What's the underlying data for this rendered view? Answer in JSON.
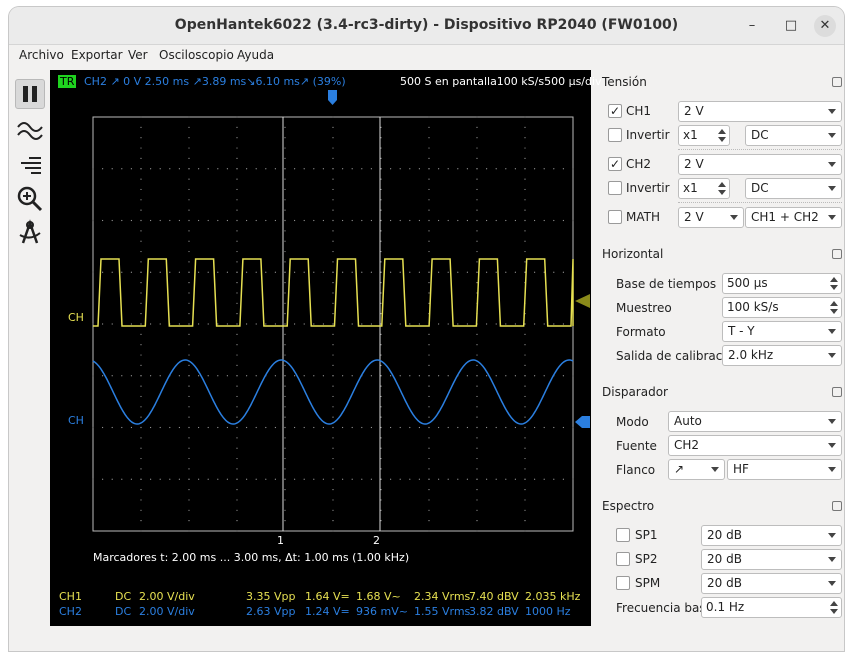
{
  "window": {
    "title": "OpenHantek6022 (3.4-rc3-dirty) - Dispositivo RP2040 (FW0100)",
    "minimize_glyph": "–",
    "maximize_glyph": "□",
    "close_glyph": "✕"
  },
  "menu": [
    "Archivo",
    "Exportar",
    "Ver",
    "Osciloscopio",
    "Ayuda"
  ],
  "toolbar": [
    "pause-icon",
    "wave-icon",
    "levels-icon",
    "zoom-icon",
    "measure-icon"
  ],
  "scope": {
    "trigger_badge": "TR",
    "header_left": "CH2  ↗  0 V  2.50 ms  ↗3.89 ms↘6.10 ms↗ (39%)",
    "header_right": "500 S en pantalla100 kS/s500 µs/div",
    "ch1_label": "CH",
    "ch2_label": "CH",
    "marker1": "1",
    "marker2": "2",
    "markers_text": "Marcadores   t: 2.00 ms ... 3.00 ms,  Δt: 1.00 ms (1.00 kHz)",
    "colors": {
      "ch1": "#e6e052",
      "ch2": "#2b7fe0",
      "grid": "#9a9a9a"
    },
    "measurements": [
      {
        "ch": "CH1",
        "coupling": "DC",
        "scale": "2.00 V/div",
        "vpp": "3.35 Vpp",
        "vdc": "1.64 V=",
        "vac": "1.68 V~",
        "vrms": "2.34 Vrms",
        "dbv": "7.40 dBV",
        "freq": "2.035 kHz"
      },
      {
        "ch": "CH2",
        "coupling": "DC",
        "scale": "2.00 V/div",
        "vpp": "2.63 Vpp",
        "vdc": "1.24 V=",
        "vac": "936 mV~",
        "vrms": "1.55 Vrms",
        "dbv": "3.82 dBV",
        "freq": "1000 Hz"
      }
    ]
  },
  "dock": {
    "tension": {
      "title": "Tensión",
      "ch1": {
        "label": "CH1",
        "checked": true,
        "volts": "2 V"
      },
      "ch1_inv": {
        "label": "Invertir",
        "checked": false,
        "probe": "x1",
        "coupling": "DC"
      },
      "ch2": {
        "label": "CH2",
        "checked": true,
        "volts": "2 V"
      },
      "ch2_inv": {
        "label": "Invertir",
        "checked": false,
        "probe": "x1",
        "coupling": "DC"
      },
      "math": {
        "label": "MATH",
        "checked": false,
        "volts": "2 V",
        "mode": "CH1 + CH2"
      }
    },
    "horizontal": {
      "title": "Horizontal",
      "timebase_label": "Base de tiempos",
      "timebase": "500 µs",
      "sample_label": "Muestreo",
      "sample": "100 kS/s",
      "format_label": "Formato",
      "format": "T - Y",
      "cal_label": "Salida de calibración",
      "cal": "2.0 kHz"
    },
    "trigger": {
      "title": "Disparador",
      "mode_label": "Modo",
      "mode": "Auto",
      "source_label": "Fuente",
      "source": "CH2",
      "slope_label": "Flanco",
      "slope": "↗",
      "filter": "HF"
    },
    "spectrum": {
      "title": "Espectro",
      "sp1": {
        "label": "SP1",
        "checked": false,
        "value": "20 dB"
      },
      "sp2": {
        "label": "SP2",
        "checked": false,
        "value": "20 dB"
      },
      "spm": {
        "label": "SPM",
        "checked": false,
        "value": "20 dB"
      },
      "freqbase_label": "Frecuencia base",
      "freqbase": "0.1 Hz"
    }
  }
}
